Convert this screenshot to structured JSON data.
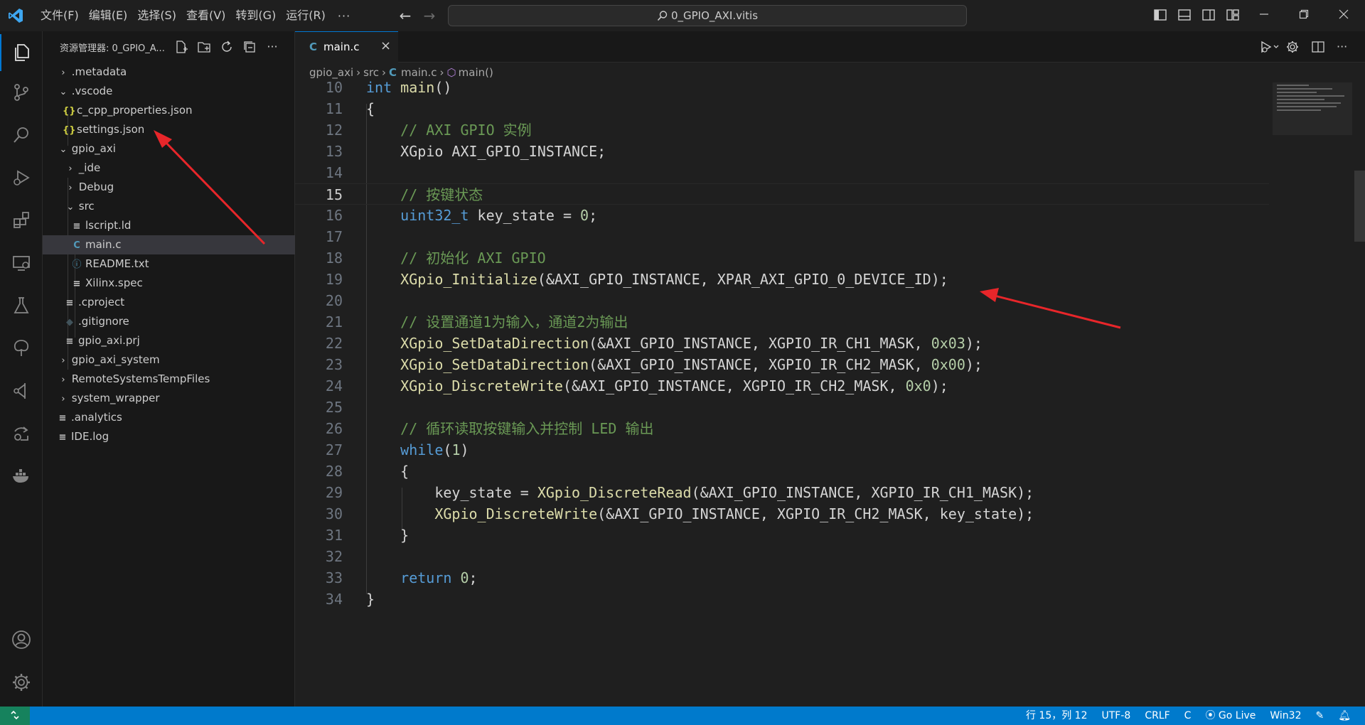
{
  "titlebar": {
    "menu": [
      "文件(F)",
      "编辑(E)",
      "选择(S)",
      "查看(V)",
      "转到(G)",
      "运行(R)"
    ],
    "more": "···",
    "search_text": "0_GPIO_AXI.vitis"
  },
  "sidebar": {
    "title": "资源管理器: 0_GPIO_A...",
    "tree": [
      {
        "label": ".metadata",
        "kind": "folder",
        "open": false
      },
      {
        "label": ".vscode",
        "kind": "folder",
        "open": true
      },
      {
        "label": "c_cpp_properties.json",
        "kind": "json"
      },
      {
        "label": "settings.json",
        "kind": "json"
      },
      {
        "label": "gpio_axi",
        "kind": "folder",
        "open": true
      },
      {
        "label": "_ide",
        "kind": "folder",
        "open": false
      },
      {
        "label": "Debug",
        "kind": "folder",
        "open": false
      },
      {
        "label": "src",
        "kind": "folder",
        "open": true
      },
      {
        "label": "lscript.ld",
        "kind": "text"
      },
      {
        "label": "main.c",
        "kind": "c"
      },
      {
        "label": "README.txt",
        "kind": "info"
      },
      {
        "label": "Xilinx.spec",
        "kind": "text"
      },
      {
        "label": ".cproject",
        "kind": "text"
      },
      {
        "label": ".gitignore",
        "kind": "git"
      },
      {
        "label": "gpio_axi.prj",
        "kind": "text"
      },
      {
        "label": "gpio_axi_system",
        "kind": "folder",
        "open": false
      },
      {
        "label": "RemoteSystemsTempFiles",
        "kind": "folder",
        "open": false
      },
      {
        "label": "system_wrapper",
        "kind": "folder",
        "open": false
      },
      {
        "label": ".analytics",
        "kind": "text"
      },
      {
        "label": "IDE.log",
        "kind": "text"
      }
    ]
  },
  "editor": {
    "tab": {
      "icon": "C",
      "label": "main.c",
      "close": "×"
    },
    "breadcrumb": {
      "p1": "gpio_axi",
      "p2": "src",
      "icon": "C",
      "p3": "main.c",
      "p4": "main()"
    },
    "current_line": 15,
    "lines": [
      {
        "n": "10",
        "t": "int main()"
      },
      {
        "n": "11",
        "t": "{"
      },
      {
        "n": "12",
        "t": "    // AXI GPIO 实例"
      },
      {
        "n": "13",
        "t": "    XGpio AXI_GPIO_INSTANCE;"
      },
      {
        "n": "14",
        "t": ""
      },
      {
        "n": "15",
        "t": "    // 按键状态"
      },
      {
        "n": "16",
        "t": "    uint32_t key_state = 0;"
      },
      {
        "n": "17",
        "t": ""
      },
      {
        "n": "18",
        "t": "    // 初始化 AXI GPIO"
      },
      {
        "n": "19",
        "t": "    XGpio_Initialize(&AXI_GPIO_INSTANCE, XPAR_AXI_GPIO_0_DEVICE_ID);"
      },
      {
        "n": "20",
        "t": ""
      },
      {
        "n": "21",
        "t": "    // 设置通道1为输入，通道2为输出"
      },
      {
        "n": "22",
        "t": "    XGpio_SetDataDirection(&AXI_GPIO_INSTANCE, XGPIO_IR_CH1_MASK, 0x03);"
      },
      {
        "n": "23",
        "t": "    XGpio_SetDataDirection(&AXI_GPIO_INSTANCE, XGPIO_IR_CH2_MASK, 0x00);"
      },
      {
        "n": "24",
        "t": "    XGpio_DiscreteWrite(&AXI_GPIO_INSTANCE, XGPIO_IR_CH2_MASK, 0x0);"
      },
      {
        "n": "25",
        "t": ""
      },
      {
        "n": "26",
        "t": "    // 循环读取按键输入并控制 LED 输出"
      },
      {
        "n": "27",
        "t": "    while(1)"
      },
      {
        "n": "28",
        "t": "    {"
      },
      {
        "n": "29",
        "t": "        key_state = XGpio_DiscreteRead(&AXI_GPIO_INSTANCE, XGPIO_IR_CH1_MASK);"
      },
      {
        "n": "30",
        "t": "        XGpio_DiscreteWrite(&AXI_GPIO_INSTANCE, XGPIO_IR_CH2_MASK, key_state);"
      },
      {
        "n": "31",
        "t": "    }"
      },
      {
        "n": "32",
        "t": ""
      },
      {
        "n": "33",
        "t": "    return 0;"
      },
      {
        "n": "34",
        "t": "}"
      }
    ]
  },
  "statusbar": {
    "position": "行 15，列 12",
    "encoding": "UTF-8",
    "eol": "CRLF",
    "language": "C",
    "golive": "Go Live",
    "platform": "Win32"
  },
  "colors": {
    "accent": "#0078d4",
    "statusbar": "#007acc",
    "keyword": "#569cd6",
    "function": "#dcdcaa",
    "comment": "#6a9955",
    "number": "#b5cea8",
    "type": "#4ec9b0",
    "bracket1": "#ffd700",
    "bracket2": "#da70d6",
    "bracket3": "#179fff",
    "annotation_arrow": "#e8262a"
  }
}
